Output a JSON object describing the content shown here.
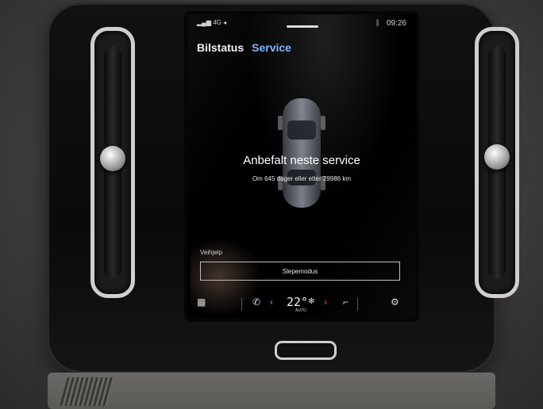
{
  "status_bar": {
    "signal_text": "4G",
    "icons": [
      "signal-icon",
      "location-icon",
      "bluetooth-icon"
    ],
    "time": "09:26"
  },
  "tabs": [
    {
      "label": "Bilstatus"
    },
    {
      "label": "Service"
    }
  ],
  "service": {
    "title": "Anbefalt neste service",
    "subtitle": "Om 645 dager eller etter 29986 km"
  },
  "help": {
    "label": "Veihjelp",
    "button_label": "Slepemodus"
  },
  "climate_bar": {
    "temperature": "22°",
    "auto_label": "AUTO",
    "icons": [
      "app-grid-icon",
      "phone-icon",
      "arrow-left-icon",
      "fan-icon",
      "arrow-right-icon",
      "seat-heat-icon",
      "settings-gear-icon"
    ]
  },
  "colors": {
    "accent_blue": "#79b4ff",
    "temp_down": "#5aa0ff",
    "temp_up": "#ff5050"
  }
}
